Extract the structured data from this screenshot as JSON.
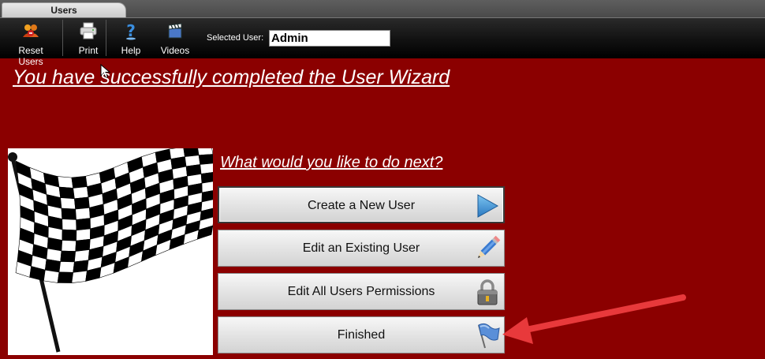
{
  "tabs": [
    {
      "label": "Users"
    }
  ],
  "toolbar": {
    "buttons": [
      {
        "label": "Reset Users",
        "icon": "reset-users-icon"
      },
      {
        "label": "Print",
        "icon": "printer-icon"
      },
      {
        "label": "Help",
        "icon": "help-icon"
      },
      {
        "label": "Videos",
        "icon": "film-clapper-icon"
      }
    ],
    "selected_user_label": "Selected User:",
    "selected_user_value": "Admin"
  },
  "main": {
    "title": "You have successfully completed the User Wizard",
    "subtitle": "What would you like to do next?",
    "actions": [
      {
        "label": "Create a New User",
        "icon": "play-arrow-icon"
      },
      {
        "label": "Edit an Existing User",
        "icon": "pencil-icon"
      },
      {
        "label": "Edit All Users Permissions",
        "icon": "padlock-icon"
      },
      {
        "label": "Finished",
        "icon": "blue-flag-icon"
      }
    ],
    "illustration": "checkered-flag"
  },
  "colors": {
    "background": "#8b0000",
    "toolbar": "#111111",
    "annotation_arrow": "#e8393b"
  }
}
